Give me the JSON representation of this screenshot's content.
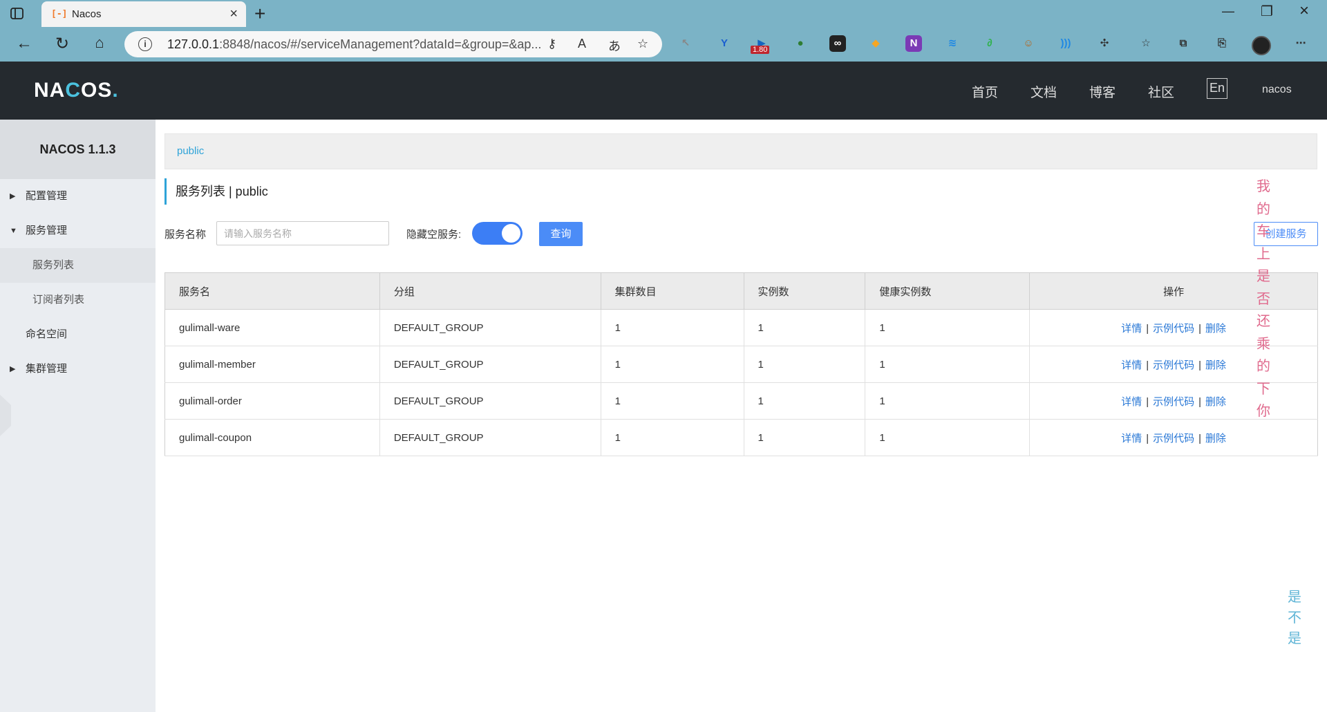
{
  "browser": {
    "tab_title": "Nacos",
    "tab_favicon": "[-]",
    "url_main": "127.0.0.1",
    "url_rest": ":8848/nacos/#/serviceManagement?dataId=&group=&ap...",
    "ext_badge": "1.80"
  },
  "header": {
    "logo_left": "NA",
    "logo_c": "C",
    "logo_right": "OS",
    "logo_dot": ".",
    "nav": [
      "首页",
      "文档",
      "博客",
      "社区"
    ],
    "lang": "En",
    "user": "nacos"
  },
  "sidebar": {
    "version": "NACOS 1.1.3",
    "items": [
      {
        "label": "配置管理",
        "arrow": "▶"
      },
      {
        "label": "服务管理",
        "arrow": "▼"
      },
      {
        "label": "服务列表"
      },
      {
        "label": "订阅者列表"
      },
      {
        "label": "命名空间"
      },
      {
        "label": "集群管理",
        "arrow": "▶"
      }
    ]
  },
  "main": {
    "breadcrumb": "public",
    "title": "服务列表 | public",
    "filter_label": "服务名称",
    "search_placeholder": "请输入服务名称",
    "hide_empty_label": "隐藏空服务:",
    "hide_empty_on": true,
    "query_button": "查询",
    "create_button": "创建服务"
  },
  "table": {
    "headers": [
      "服务名",
      "分组",
      "集群数目",
      "实例数",
      "健康实例数",
      "操作"
    ],
    "rows": [
      [
        "gulimall-ware",
        "DEFAULT_GROUP",
        "1",
        "1",
        "1"
      ],
      [
        "gulimall-member",
        "DEFAULT_GROUP",
        "1",
        "1",
        "1"
      ],
      [
        "gulimall-order",
        "DEFAULT_GROUP",
        "1",
        "1",
        "1"
      ],
      [
        "gulimall-coupon",
        "DEFAULT_GROUP",
        "1",
        "1",
        "1"
      ]
    ],
    "ops": {
      "detail": "详情",
      "sample": "示例代码",
      "delete": "删除",
      "sep": "|"
    }
  },
  "overlay": {
    "pink_chars": [
      "我",
      "的",
      "车",
      "上",
      "是",
      "否",
      "还",
      "乘",
      "的",
      "下",
      "你"
    ],
    "blue_chars": [
      "是",
      "不",
      "是"
    ]
  },
  "colors": {
    "header_bg": "#252a2f",
    "accent": "#2ea3d8",
    "primary_button": "#4b8cf7",
    "link": "#2a78d6",
    "browser_chrome": "#7bb3c6"
  }
}
